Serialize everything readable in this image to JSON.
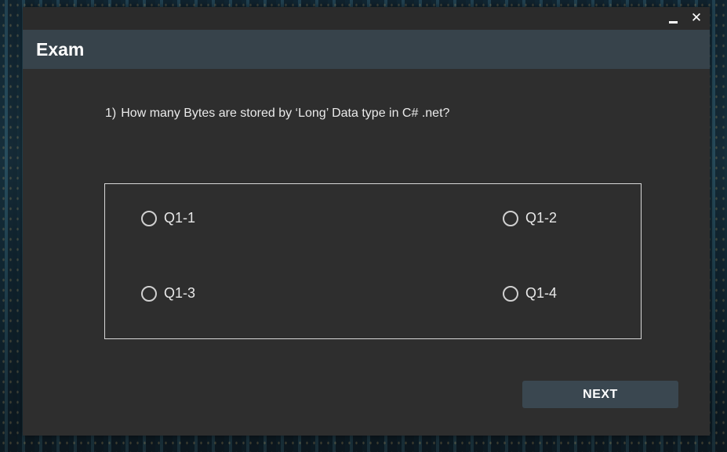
{
  "window": {
    "minimize_icon": "minimize-icon",
    "close_icon": "close-icon",
    "close_glyph": "✕"
  },
  "header": {
    "title": "Exam"
  },
  "question": {
    "number": "1)",
    "text": "How many Bytes are stored by ‘Long’ Data type in C# .net?"
  },
  "options": [
    {
      "label": "Q1-1",
      "selected": false
    },
    {
      "label": "Q1-2",
      "selected": false
    },
    {
      "label": "Q1-3",
      "selected": false
    },
    {
      "label": "Q1-4",
      "selected": false
    }
  ],
  "actions": {
    "next_label": "NEXT"
  },
  "colors": {
    "window_bg": "#2e2e2e",
    "header_bg": "#37434b",
    "button_bg": "#3a4750",
    "text": "#ffffff"
  }
}
